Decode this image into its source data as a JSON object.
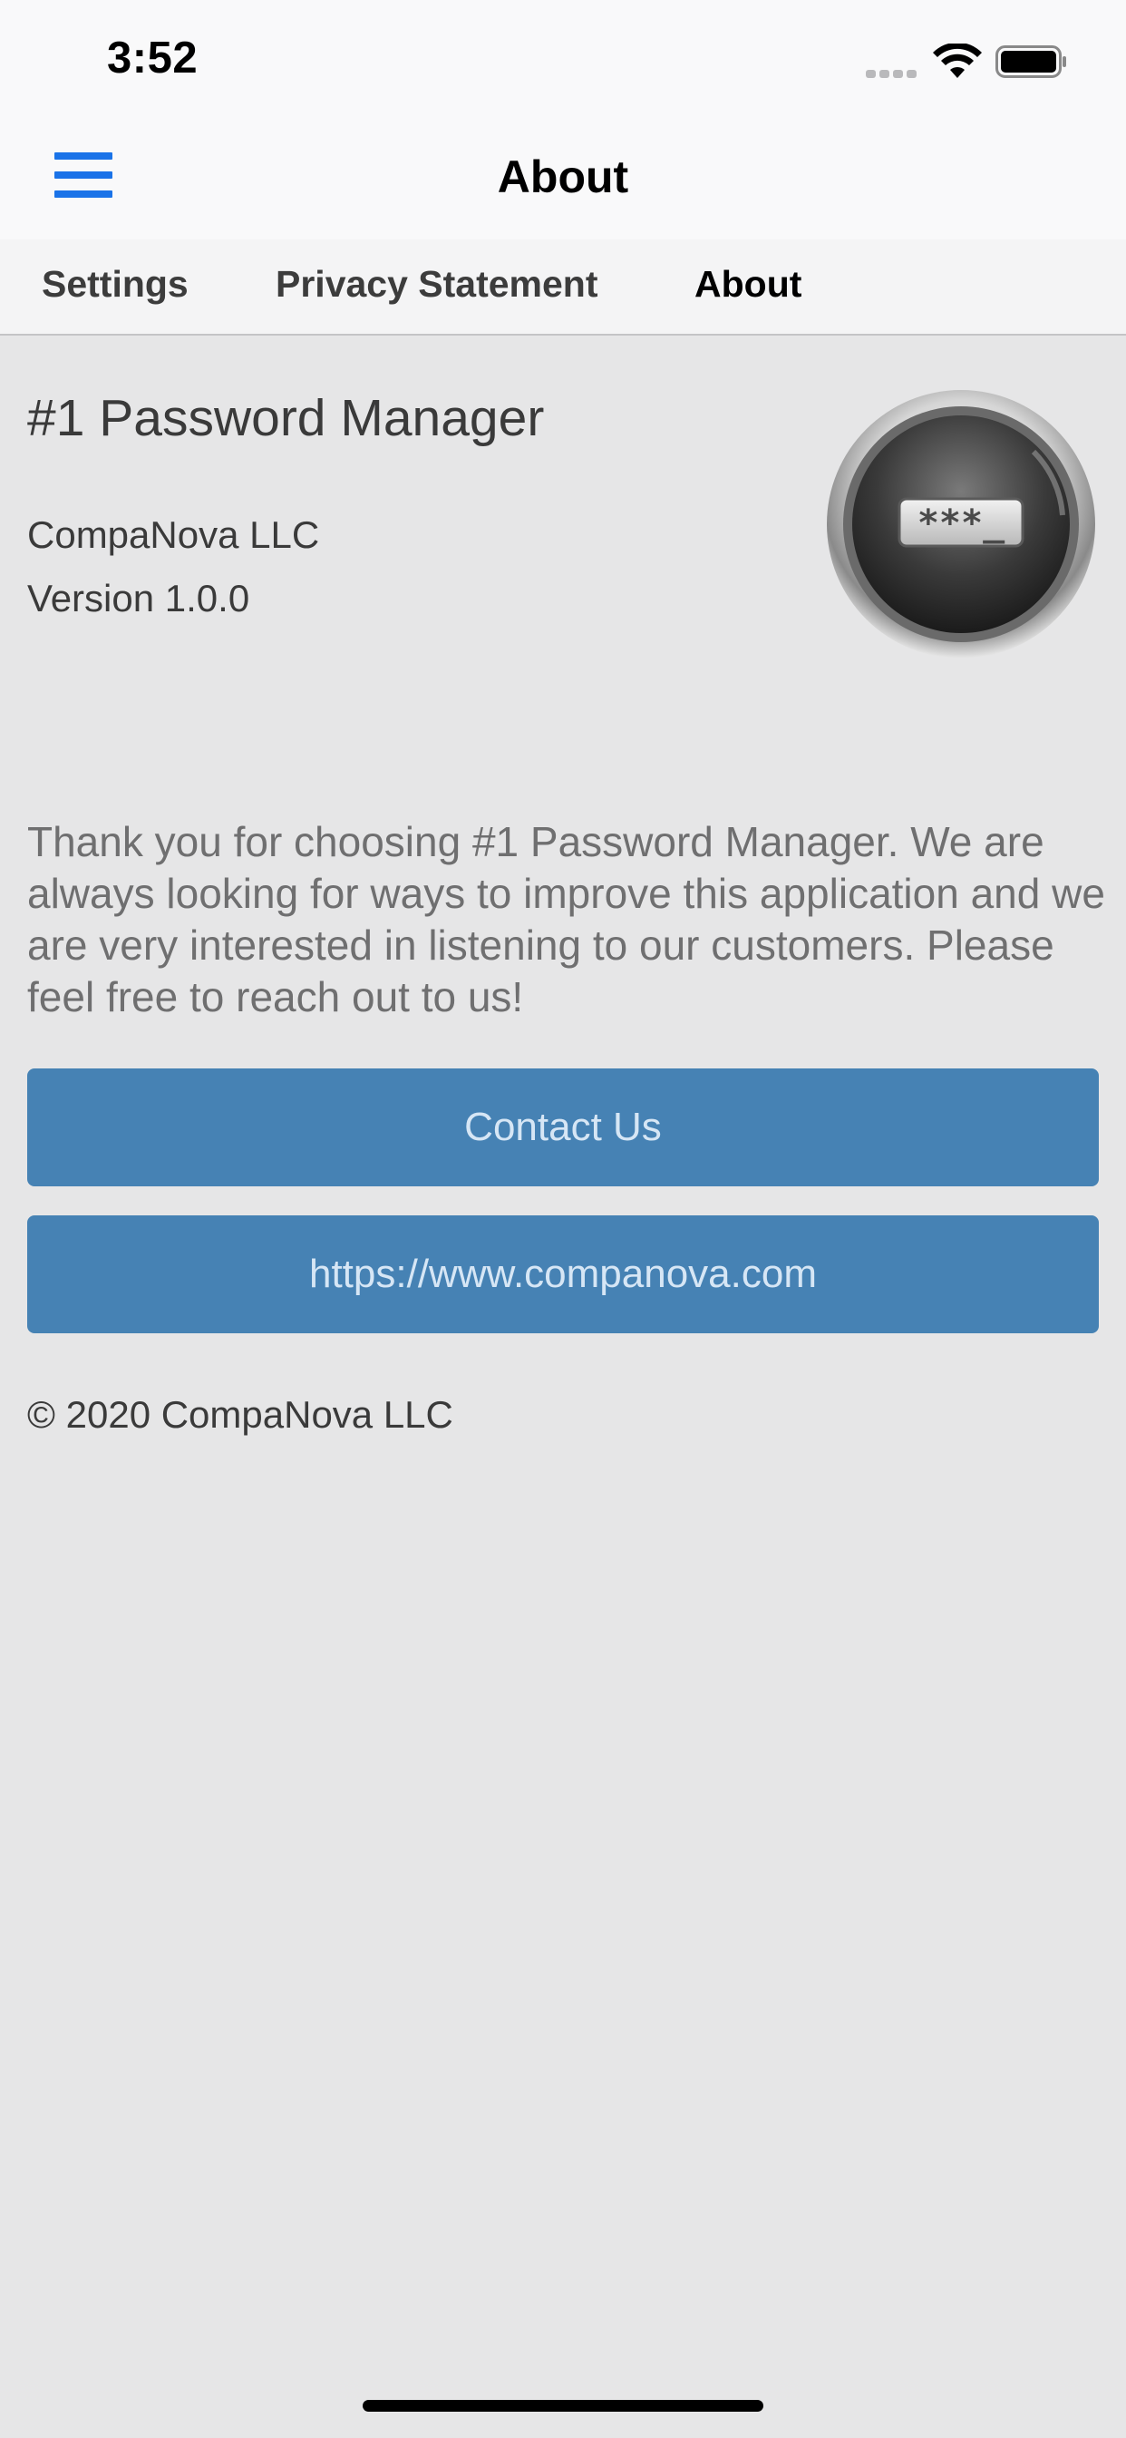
{
  "status_bar": {
    "time": "3:52",
    "icons": [
      "signal-icon",
      "wifi-icon",
      "battery-icon"
    ]
  },
  "nav": {
    "title": "About",
    "menu_icon": "hamburger-menu-icon"
  },
  "tabs": [
    {
      "label": "Settings",
      "active": false
    },
    {
      "label": "Privacy Statement",
      "active": false
    },
    {
      "label": "About",
      "active": true
    }
  ],
  "about": {
    "app_name": "#1 Password Manager",
    "company": "CompaNova LLC",
    "version": "Version 1.0.0",
    "logo_icon": "password-app-logo-icon",
    "logo_text": "***_",
    "description": "Thank you for choosing #1 Password Manager. We are always looking for ways to improve this application and we are very interested in listening to our customers. Please feel free to reach out to us!",
    "contact_button": "Contact Us",
    "website_button": "https://www.companova.com",
    "copyright": "© 2020 CompaNova LLC"
  },
  "colors": {
    "accent": "#1a73e8",
    "button": "#4682b4",
    "background": "#e6e6e7"
  }
}
